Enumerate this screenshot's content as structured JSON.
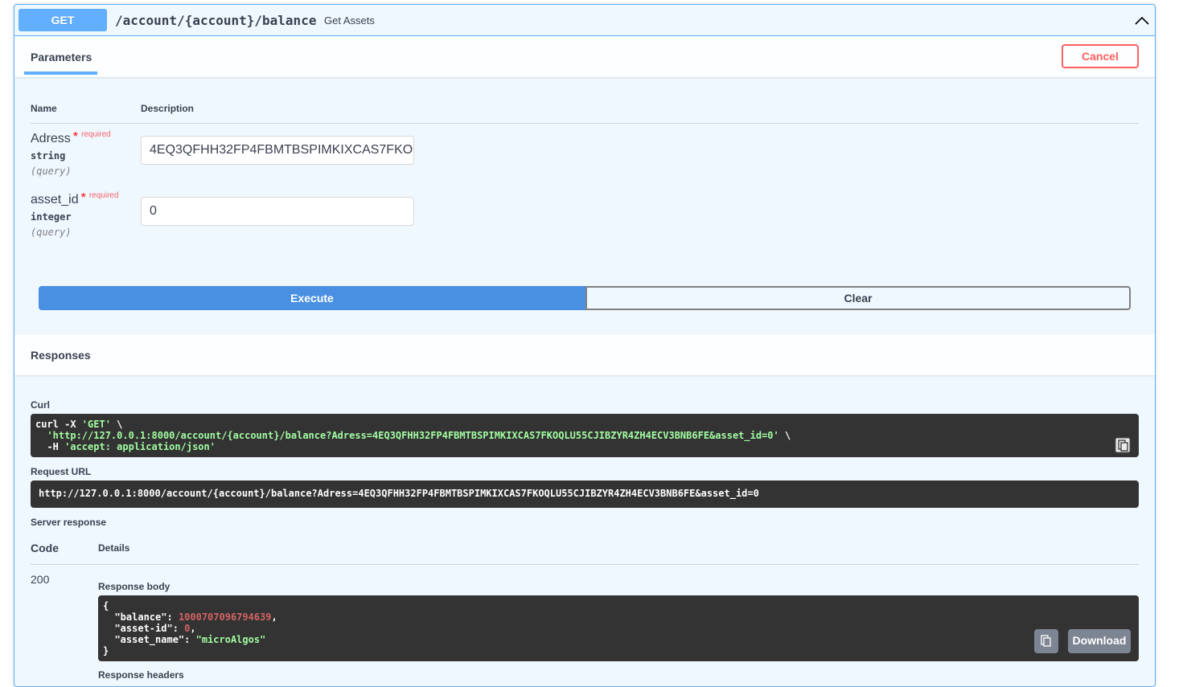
{
  "endpoint": {
    "method": "GET",
    "path": "/account/{account}/balance",
    "summary": "Get Assets"
  },
  "parameters": {
    "title": "Parameters",
    "cancel_label": "Cancel",
    "col_name": "Name",
    "col_description": "Description",
    "items": [
      {
        "name": "Adress",
        "star": "*",
        "required": "required",
        "type": "string",
        "in": "(query)",
        "value": "4EQ3QFHH32FP4FBMTBSPIMKIXCAS7FKOQLU55CJIBZYR4ZH4ECV3BNB6FE"
      },
      {
        "name": "asset_id",
        "star": "*",
        "required": "required",
        "type": "integer",
        "in": "(query)",
        "value": "0"
      }
    ],
    "execute_label": "Execute",
    "clear_label": "Clear"
  },
  "responses": {
    "title": "Responses",
    "curl_label": "Curl",
    "curl": {
      "line1_cmd": "curl -X ",
      "line1_method": "'GET'",
      "line1_end": " \\",
      "line2_pre": "  ",
      "line2_url": "'http://127.0.0.1:8000/account/{account}/balance?Adress=4EQ3QFHH32FP4FBMTBSPIMKIXCAS7FKOQLU55CJIBZYR4ZH4ECV3BNB6FE&asset_id=0'",
      "line2_end": " \\",
      "line3_pre": "  -H ",
      "line3_header": "'accept: application/json'"
    },
    "request_url_label": "Request URL",
    "request_url": "http://127.0.0.1:8000/account/{account}/balance?Adress=4EQ3QFHH32FP4FBMTBSPIMKIXCAS7FKOQLU55CJIBZYR4ZH4ECV3BNB6FE&asset_id=0",
    "server_response_label": "Server response",
    "col_code": "Code",
    "col_details": "Details",
    "code": "200",
    "response_body_label": "Response body",
    "body": {
      "open": "{",
      "balance_key": "\"balance\"",
      "balance_val": "1000707096794639",
      "asset_id_key": "\"asset-id\"",
      "asset_id_val": "0",
      "asset_name_key": "\"asset_name\"",
      "asset_name_val": "\"microAlgos\"",
      "close": "}"
    },
    "download_label": "Download",
    "response_headers_label": "Response headers"
  },
  "colors": {
    "get_blue": "#61affe",
    "execute_blue": "#4990e2",
    "cancel_red": "#ff6060",
    "code_bg": "#333333"
  }
}
